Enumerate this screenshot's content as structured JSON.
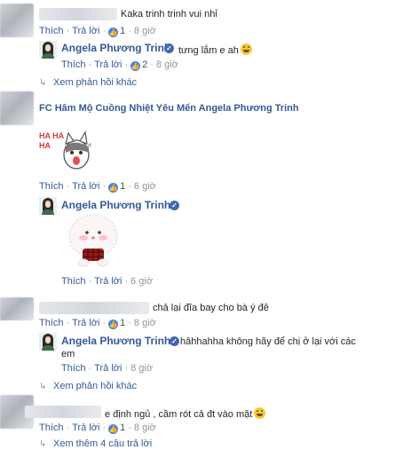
{
  "actions": {
    "like": "Thích",
    "reply": "Trả lời",
    "dot": "·"
  },
  "comments": [
    {
      "text": "Kaka trinh trinh vui nhỉ",
      "likes": "1",
      "time": "8 giờ",
      "replies": [
        {
          "author": "Angela Phương Trinh",
          "text": "tưng lắm e ah",
          "likes": "2",
          "time": "8 giờ",
          "emoji": "grinning-face-with-tongue"
        }
      ],
      "more": "Xem phản hồi khác"
    },
    {
      "author": "FC Hâm Mộ Cuồng Nhiệt Yêu Mến Angela Phương Trinh",
      "sticker_text": "HA HA HA",
      "likes": "1",
      "time": "6 giờ",
      "replies": [
        {
          "author": "Angela Phương Trinh",
          "time": "6 giờ",
          "sticker": "fluffy-white-creature-sticker"
        }
      ]
    },
    {
      "text": "chả lại đĩa bay cho bà ý đê",
      "likes": "1",
      "time": "8 giờ",
      "replies": [
        {
          "author": "Angela Phương Trinh",
          "text_line1": "hâhhahha không hãy để chị ở lại với các",
          "text_line2": "em",
          "time": "8 giờ"
        }
      ],
      "more": "Xem phản hồi khác"
    },
    {
      "text": "e định ngủ , cầm rót cả đt vào mặt",
      "likes": "1",
      "time": "8 giờ",
      "more": "Xem thêm 4 câu trả lời",
      "emoji": "grinning-face-with-tongue"
    }
  ],
  "colors": {
    "link": "#365899",
    "text": "#1d2129",
    "meta": "#90949c",
    "like_badge": "#4080ff"
  }
}
